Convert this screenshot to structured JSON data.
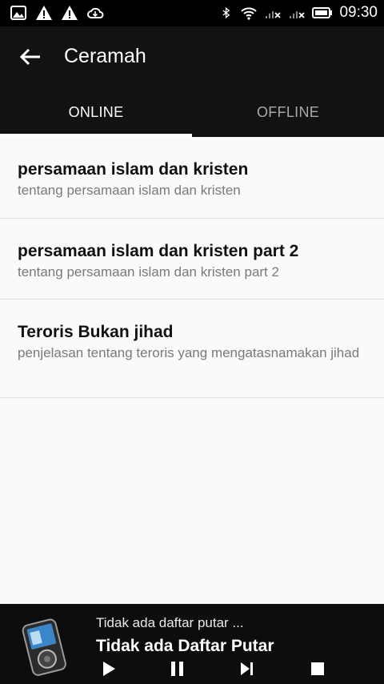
{
  "status_bar": {
    "time": "09:30",
    "left_icons": [
      "gallery-icon",
      "warning-icon",
      "warning-icon",
      "cloud-icon"
    ],
    "right_icons": [
      "bluetooth-icon",
      "wifi-icon",
      "signal-1-icon",
      "signal-2-icon",
      "battery-icon"
    ]
  },
  "toolbar": {
    "title": "Ceramah",
    "back_icon": "arrow-left-icon"
  },
  "tabs": [
    {
      "label": "ONLINE",
      "active": true
    },
    {
      "label": "OFFLINE",
      "active": false
    }
  ],
  "items": [
    {
      "title": "persamaan islam dan kristen",
      "subtitle": "tentang persamaan islam dan kristen"
    },
    {
      "title": "persamaan islam dan kristen part 2",
      "subtitle": "tentang persamaan islam dan kristen part 2"
    },
    {
      "title": "Teroris Bukan jihad",
      "subtitle": "penjelasan tentang teroris yang mengatasnamakan jihad"
    }
  ],
  "player": {
    "subtitle": "Tidak ada daftar putar ...",
    "title": "Tidak ada Daftar Putar",
    "controls": [
      "play-icon",
      "pause-icon",
      "skip-next-icon",
      "stop-icon"
    ]
  },
  "colors": {
    "bar_background": "#121212",
    "list_background": "#fafafa",
    "active_tab": "#ffffff",
    "inactive_tab": "#a9a9a9"
  }
}
